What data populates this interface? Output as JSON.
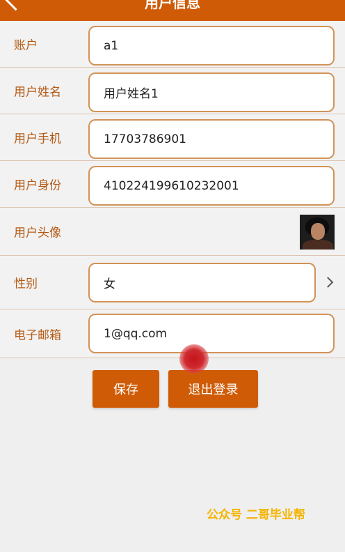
{
  "header": {
    "title": "用户信息",
    "back_icon": "chevron-left-icon"
  },
  "form": {
    "account": {
      "label": "账户",
      "value": "a1"
    },
    "username": {
      "label": "用户姓名",
      "value": "用户姓名1"
    },
    "phone": {
      "label": "用户手机",
      "value": "17703786901"
    },
    "id_number": {
      "label": "用户身份",
      "value": "410224199610232001"
    },
    "avatar": {
      "label": "用户头像"
    },
    "gender": {
      "label": "性别",
      "value": "女",
      "icon": "chevron-right-icon"
    },
    "email": {
      "label": "电子邮箱",
      "value": "1@qq.com"
    }
  },
  "actions": {
    "save_label": "保存",
    "logout_label": "退出登录"
  },
  "watermark": "公众号 二哥毕业帮",
  "colors": {
    "accent": "#cf5b06",
    "label": "#b45a14",
    "field_border": "#d29358",
    "background": "#efefef"
  }
}
